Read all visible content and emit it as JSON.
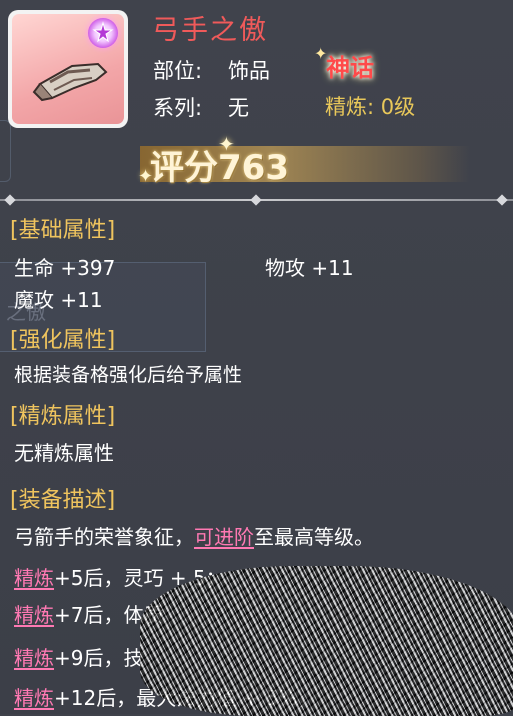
{
  "item": {
    "name": "弓手之傲",
    "slot_label": "部位:",
    "slot_value": "饰品",
    "series_label": "系列:",
    "series_value": "无",
    "rarity": "神话",
    "refine": "精炼: 0级",
    "score_prefix": "评分",
    "score_value": "763"
  },
  "sections": {
    "base_title": "[基础属性]",
    "base_stats": [
      "生命 +397",
      "物攻 +11",
      "魔攻 +11"
    ],
    "enhance_title": "[强化属性]",
    "enhance_text": "根据装备格强化后给予属性",
    "refine_title": "[精炼属性]",
    "refine_text": "无精炼属性",
    "desc_title": "[装备描述]",
    "desc_pre": "弓箭手的荣誉象征，",
    "desc_link": "可进阶",
    "desc_post": "至最高等级。",
    "refine_lines": [
      {
        "link": "精炼",
        "text": "+5后，灵巧 + 5；"
      },
      {
        "link": "精炼",
        "text": "+7后，体质"
      },
      {
        "link": "精炼",
        "text": "+9后，技"
      },
      {
        "link": "精炼",
        "text": "+12后，最大法力值 + 5%，"
      }
    ]
  },
  "ghost_text": "之傲",
  "colors": {
    "title": "#f05a5a",
    "section": "#efc45e",
    "link": "#ff79b3",
    "refine": "#e9c85a"
  }
}
